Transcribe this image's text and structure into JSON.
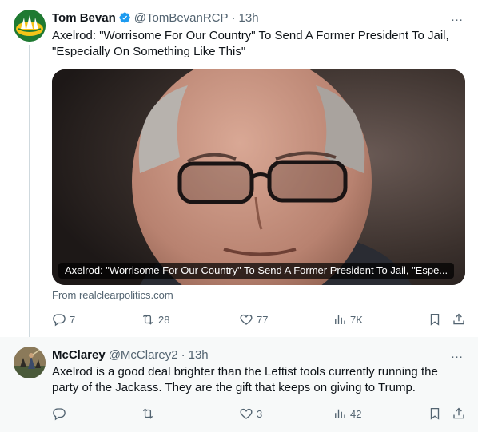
{
  "tweets": [
    {
      "author_name": "Tom Bevan",
      "handle": "@TomBevanRCP",
      "separator": "·",
      "time": "13h",
      "verified": true,
      "text_lines": [
        "Axelrod: \"Worrisome For Our Country\" To Send A Former President To Jail,",
        "\"Especially On Something Like This\""
      ],
      "card": {
        "caption": "Axelrod: \"Worrisome For Our Country\" To Send A Former President To Jail, \"Espe...",
        "source": "From realclearpolitics.com"
      },
      "actions": {
        "replies": "7",
        "reposts": "28",
        "likes": "77",
        "views": "7K"
      }
    },
    {
      "author_name": "McClarey",
      "handle": "@McClarey2",
      "separator": "·",
      "time": "13h",
      "verified": false,
      "text_lines": [
        "Axelrod is a good deal brighter than the Leftist tools currently running the",
        "party of the Jackass.  They are the gift that keeps on giving to Trump."
      ],
      "actions": {
        "replies": "",
        "reposts": "",
        "likes": "3",
        "views": "42"
      }
    }
  ],
  "more_icon": "…",
  "colors": {
    "text_primary": "#0f1419",
    "text_secondary": "#536471",
    "verified_blue": "#1d9bf0",
    "thread_line": "#cfd9de"
  }
}
